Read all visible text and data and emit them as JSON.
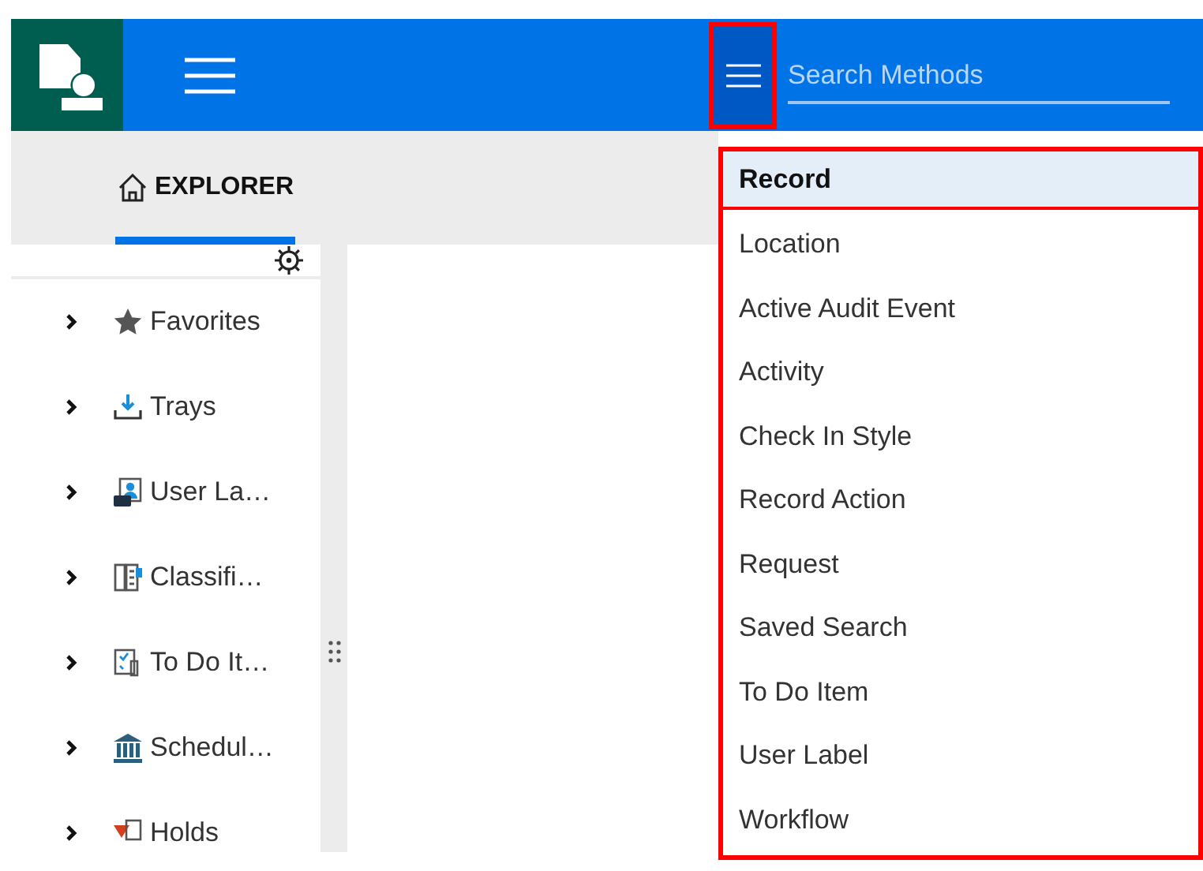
{
  "header": {
    "search": {
      "placeholder": "Search Methods"
    },
    "search_menu_button": {
      "highlighted": true
    }
  },
  "tabs": [
    {
      "label": "EXPLORER",
      "selected": true
    }
  ],
  "sidebar": {
    "items": [
      {
        "label": "Favorites",
        "expanded": false
      },
      {
        "label": "Trays",
        "expanded": false
      },
      {
        "label": "User La…",
        "expanded": false
      },
      {
        "label": "Classifi…",
        "expanded": false
      },
      {
        "label": "To Do It…",
        "expanded": false
      },
      {
        "label": "Schedul…",
        "expanded": false
      },
      {
        "label": "Holds",
        "expanded": false
      }
    ]
  },
  "search_methods_menu": {
    "highlighted": true,
    "items": [
      {
        "label": "Record",
        "selected": true
      },
      {
        "label": "Location",
        "selected": false
      },
      {
        "label": "Active Audit Event",
        "selected": false
      },
      {
        "label": "Activity",
        "selected": false
      },
      {
        "label": "Check In Style",
        "selected": false
      },
      {
        "label": "Record Action",
        "selected": false
      },
      {
        "label": "Request",
        "selected": false
      },
      {
        "label": "Saved Search",
        "selected": false
      },
      {
        "label": "To Do Item",
        "selected": false
      },
      {
        "label": "User Label",
        "selected": false
      },
      {
        "label": "Workflow",
        "selected": false
      }
    ]
  }
}
